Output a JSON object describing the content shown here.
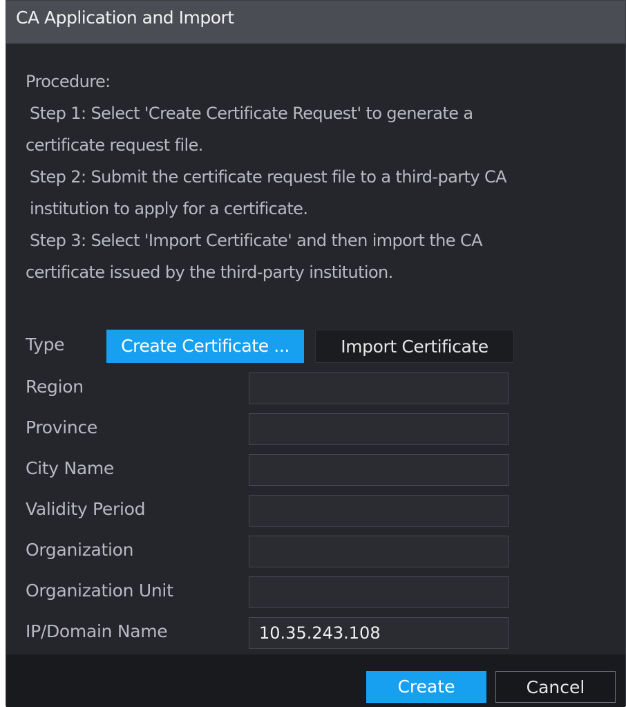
{
  "dialog": {
    "title": "CA Application and Import"
  },
  "procedure": {
    "heading": "Procedure:",
    "lines": [
      " Step 1: Select 'Create Certificate Request' to generate a",
      "certificate request file.",
      " Step 2: Submit the certificate request file to a third-party CA",
      " institution to apply for a certificate.",
      " Step 3: Select 'Import Certificate' and then import the CA",
      "certificate issued by the third-party institution."
    ]
  },
  "type": {
    "label": "Type",
    "options": [
      {
        "label": "Create Certificate ...",
        "selected": true
      },
      {
        "label": "Import Certificate",
        "selected": false
      }
    ]
  },
  "form": {
    "fields": [
      {
        "label": "Region",
        "value": ""
      },
      {
        "label": "Province",
        "value": ""
      },
      {
        "label": "City Name",
        "value": ""
      },
      {
        "label": "Validity Period",
        "value": ""
      },
      {
        "label": "Organization",
        "value": ""
      },
      {
        "label": "Organization Unit",
        "value": ""
      },
      {
        "label": "IP/Domain Name",
        "value": "10.35.243.108"
      }
    ]
  },
  "footer": {
    "create_label": "Create",
    "cancel_label": "Cancel"
  },
  "colors": {
    "accent": "#18a0f0",
    "dialog_bg": "#24262b",
    "titlebar_bg": "#4a4d54",
    "footer_bg": "#181a1d"
  }
}
